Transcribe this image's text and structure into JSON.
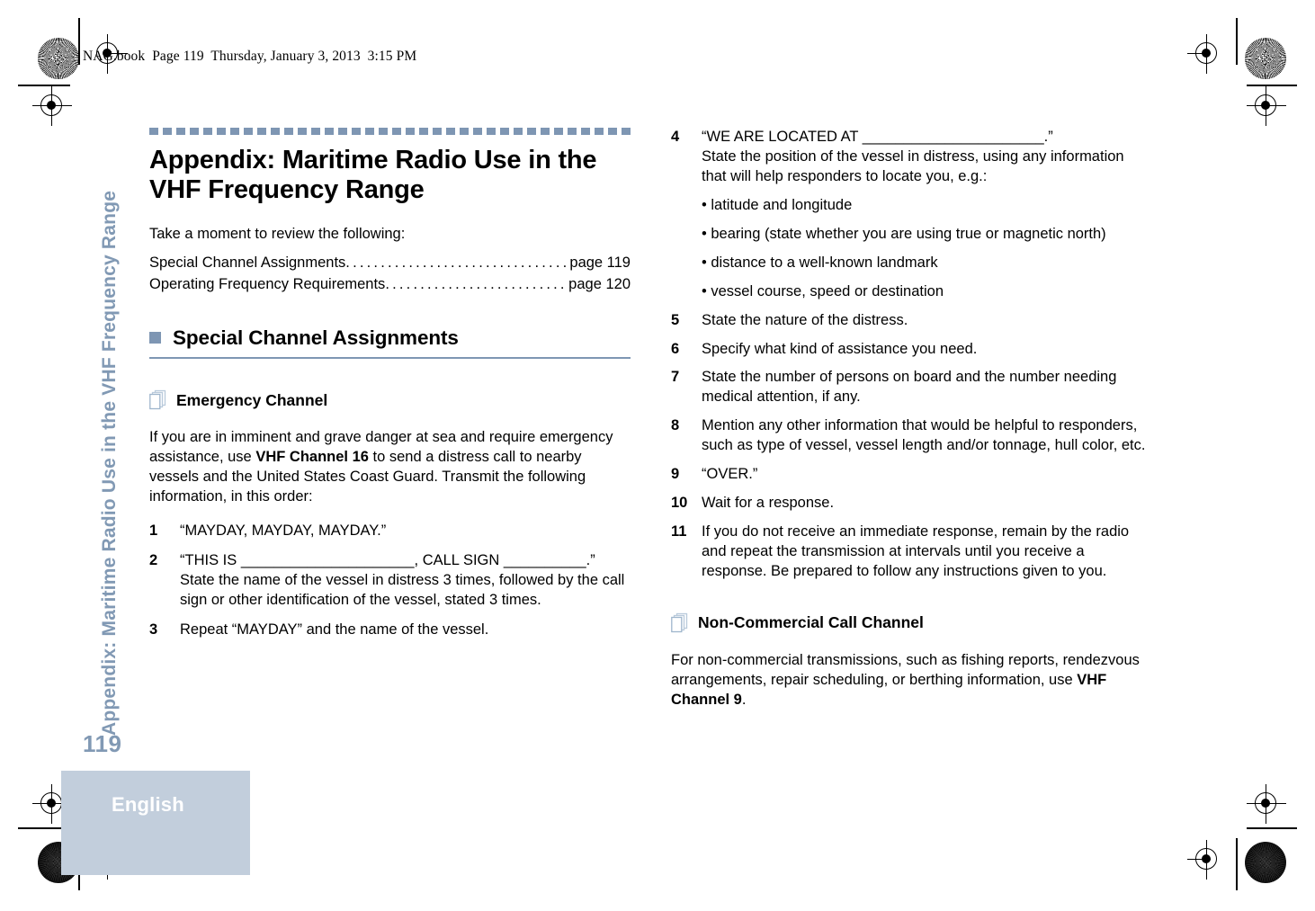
{
  "file_header": "NAG.book  Page 119  Thursday, January 3, 2013  3:15 PM",
  "sidebar": {
    "running_head": "Appendix: Maritime Radio Use in the VHF Frequency Range",
    "page_number": "119",
    "language_label": "English",
    "accent_color": "#8199B4",
    "block_color": "#C2CEDC"
  },
  "left_column": {
    "chapter_title": "Appendix: Maritime Radio Use in the VHF Frequency Range",
    "intro": "Take a moment to review the following:",
    "toc": [
      {
        "label": "Special Channel Assignments",
        "page": "page 119"
      },
      {
        "label": "Operating Frequency Requirements",
        "page": "page 120"
      }
    ],
    "section_title": "Special Channel Assignments",
    "subsection_title": "Emergency Channel",
    "body_1_a": "If you are in imminent and grave danger at sea and require emergency assistance, use ",
    "body_1_bold": "VHF Channel 16",
    "body_1_b": " to send a distress call to nearby vessels and the United States Coast Guard. Transmit the following information, in this order:",
    "steps": [
      {
        "num": "1",
        "text": "“MAYDAY, MAYDAY, MAYDAY.”",
        "sub": ""
      },
      {
        "num": "2",
        "text": "“THIS IS _____________________, CALL SIGN __________.”",
        "sub": "State the name of the vessel in distress 3 times, followed by the call sign or other identification of the vessel, stated 3 times."
      },
      {
        "num": "3",
        "text": "Repeat “MAYDAY” and the name of the vessel.",
        "sub": ""
      }
    ]
  },
  "right_column": {
    "steps": [
      {
        "num": "4",
        "text": "“WE ARE LOCATED AT ______________________.”",
        "sub": "State the position of the vessel in distress, using any information that will help responders to locate you, e.g.:"
      },
      {
        "num": "5",
        "text": "State the nature of the distress.",
        "sub": ""
      },
      {
        "num": "6",
        "text": "Specify what kind of assistance you need.",
        "sub": ""
      },
      {
        "num": "7",
        "text": "State the number of persons on board and the number needing medical attention, if any.",
        "sub": ""
      },
      {
        "num": "8",
        "text": "Mention any other information that would be helpful to responders, such as type of vessel, vessel length and/or tonnage, hull color, etc.",
        "sub": ""
      },
      {
        "num": "9",
        "text": "“OVER.”",
        "sub": ""
      },
      {
        "num": "10",
        "text": "Wait for a response.",
        "sub": ""
      },
      {
        "num": "11",
        "text": "If you do not receive an immediate response, remain by the radio and repeat the transmission at intervals until you receive a response. Be prepared to follow any instructions given to you.",
        "sub": ""
      }
    ],
    "step4_bullets": [
      "• latitude and longitude",
      "• bearing (state whether you are using true or magnetic north)",
      "• distance to a well-known landmark",
      "• vessel course, speed or destination"
    ],
    "subsection_title": "Non-Commercial Call Channel",
    "body_2_a": "For non-commercial transmissions, such as fishing reports, rendezvous arrangements, repair scheduling, or berthing information, use ",
    "body_2_bold": "VHF Channel 9",
    "body_2_b": "."
  }
}
